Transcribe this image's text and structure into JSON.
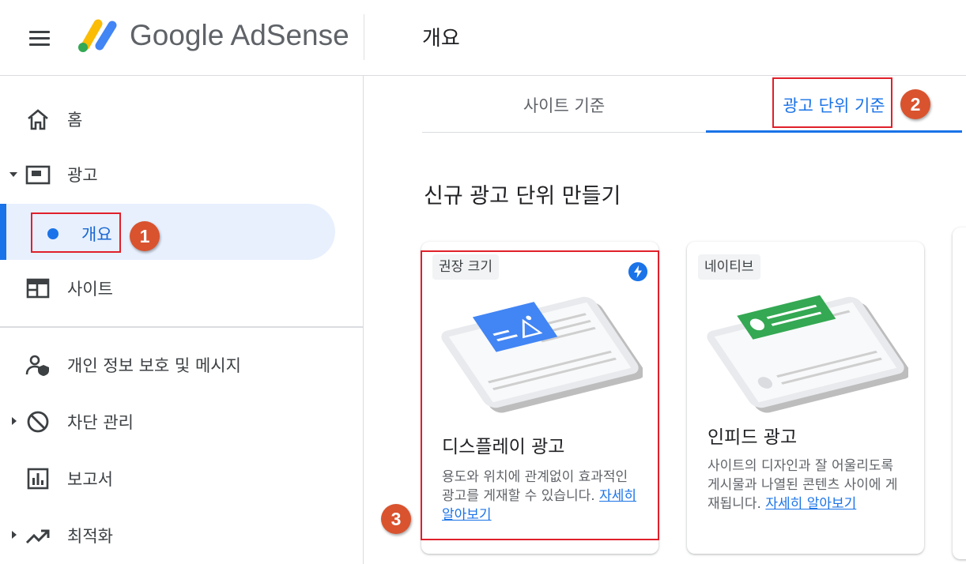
{
  "header": {
    "brand": "Google AdSense",
    "page_title": "개요"
  },
  "sidebar": {
    "items": [
      {
        "label": "홈",
        "icon": "home-icon"
      },
      {
        "label": "광고",
        "icon": "ads-icon",
        "expanded": true
      },
      {
        "label": "개요",
        "active": true
      },
      {
        "label": "사이트",
        "icon": "sites-icon"
      },
      {
        "label": "개인 정보 보호 및 메시지",
        "icon": "privacy-icon"
      },
      {
        "label": "차단 관리",
        "icon": "block-icon",
        "expandable": true
      },
      {
        "label": "보고서",
        "icon": "report-icon"
      },
      {
        "label": "최적화",
        "icon": "trending-icon",
        "expandable": true
      }
    ]
  },
  "tabs": [
    {
      "label": "사이트 기준",
      "selected": false
    },
    {
      "label": "광고 단위 기준",
      "selected": true
    }
  ],
  "section_title": "신규 광고 단위 만들기",
  "cards": [
    {
      "chip": "권장 크기",
      "title": "디스플레이 광고",
      "description": "용도와 위치에 관계없이 효과적인 광고를 게재할 수 있습니다.",
      "link": "자세히 알아보기",
      "badge_icon": "bolt-icon"
    },
    {
      "chip": "네이티브",
      "title": "인피드 광고",
      "description": "사이트의 디자인과 잘 어울리도록 게시물과 나열된 콘텐츠 사이에 게재됩니다.",
      "link": "자세히 알아보기"
    }
  ],
  "annotations": [
    "1",
    "2",
    "3"
  ],
  "colors": {
    "accent": "#1a73e8",
    "active_bg": "#e8f0fe",
    "annotation_box": "#e0202a",
    "annotation_badge": "#d9532f"
  }
}
